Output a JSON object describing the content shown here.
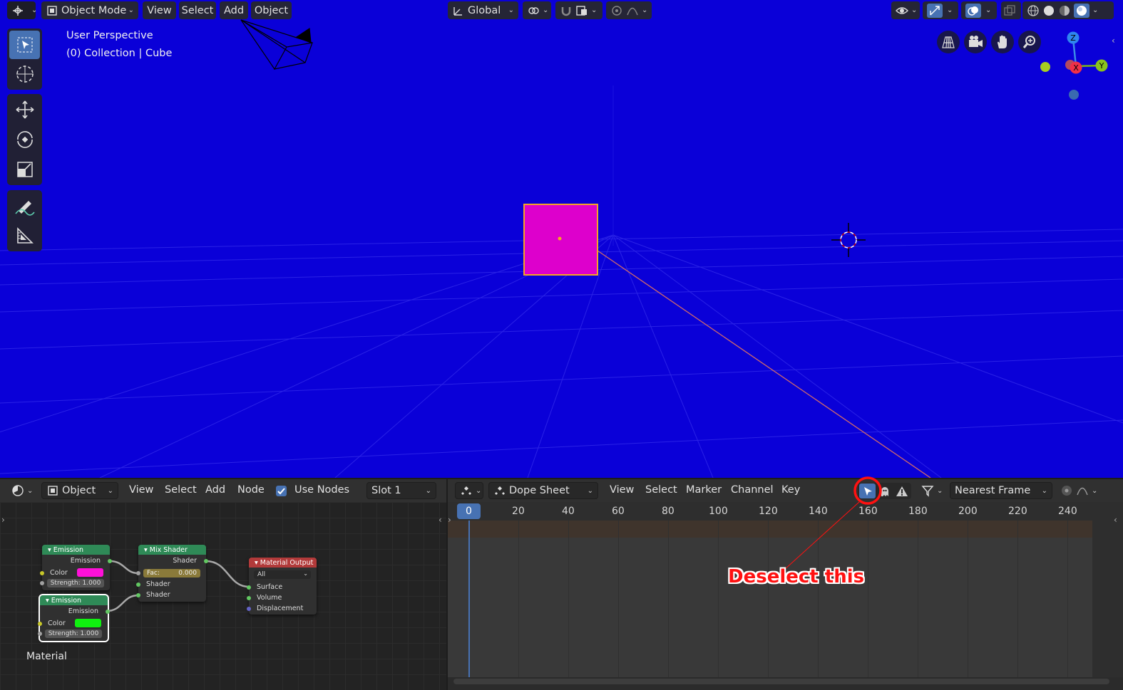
{
  "viewport": {
    "header": {
      "editor_type_icon": "view3d-icon",
      "mode_label": "Object Mode",
      "menus": [
        "View",
        "Select",
        "Add",
        "Object"
      ],
      "transform_orientation": "Global"
    },
    "overlay": {
      "perspective": "User Perspective",
      "collection": "(0) Collection | Cube"
    },
    "gizmo_axes": {
      "z": "Z",
      "y": "Y",
      "x": "X"
    },
    "tools": [
      "select-box-icon",
      "cursor-icon",
      "move-icon",
      "rotate-icon",
      "scale-icon",
      "annotate-icon",
      "measure-icon"
    ],
    "cube_color": "#dd00cc",
    "background_color": "#0a00d8"
  },
  "node_editor": {
    "header": {
      "object_type": "Object",
      "menus": [
        "View",
        "Select",
        "Add",
        "Node"
      ],
      "use_nodes_label": "Use Nodes",
      "use_nodes_checked": true,
      "slot": "Slot 1"
    },
    "material_label": "Material",
    "nodes": {
      "emission1": {
        "title": "Emission",
        "output": "Emission",
        "color_label": "Color",
        "color": "#ff10d8",
        "strength": "Strength: 1.000"
      },
      "emission2": {
        "title": "Emission",
        "output": "Emission",
        "color_label": "Color",
        "color": "#10f010",
        "strength": "Strength: 1.000"
      },
      "mix": {
        "title": "Mix Shader",
        "output": "Shader",
        "fac_label": "Fac:",
        "fac_value": "0.000",
        "input1": "Shader",
        "input2": "Shader"
      },
      "output": {
        "title": "Material Output",
        "target": "All",
        "surface": "Surface",
        "volume": "Volume",
        "displacement": "Displacement"
      }
    }
  },
  "dope_sheet": {
    "header": {
      "mode": "Dope Sheet",
      "menus": [
        "View",
        "Select",
        "Marker",
        "Channel",
        "Key"
      ],
      "snap": "Nearest Frame"
    },
    "current_frame": "0",
    "frame_ticks": [
      "20",
      "40",
      "60",
      "80",
      "100",
      "120",
      "140",
      "160",
      "180",
      "200",
      "220",
      "240"
    ]
  },
  "annotation": {
    "text": "Deselect this",
    "color": "#ff1111"
  }
}
